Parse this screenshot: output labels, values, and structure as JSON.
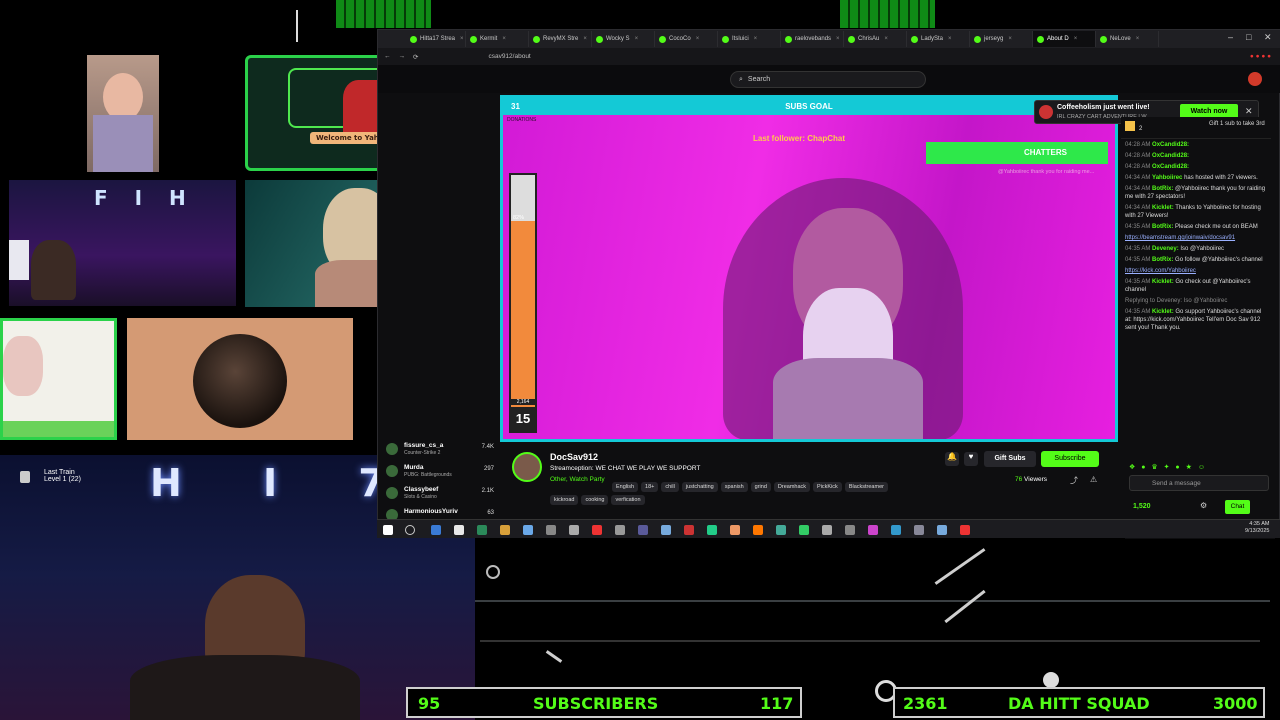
{
  "browser": {
    "tabs": [
      {
        "label": "Hitta17 Strea"
      },
      {
        "label": "Kermit"
      },
      {
        "label": "RevyMX Stre"
      },
      {
        "label": "Wocky S"
      },
      {
        "label": "CocoCo"
      },
      {
        "label": "Itsluici"
      },
      {
        "label": "raelovebands"
      },
      {
        "label": "ChrisAu"
      },
      {
        "label": "LadySta"
      },
      {
        "label": "jerseyg"
      },
      {
        "label": "About D",
        "active": true
      },
      {
        "label": "NeLove"
      }
    ],
    "url": "csav912/about"
  },
  "kick": {
    "search_placeholder": "Search"
  },
  "video_overlay": {
    "goal_count": "31",
    "goal_title": "SUBS GOAL",
    "donations_label": "DONATIONS",
    "last_follower": "Last follower: ChapChat",
    "chatters": "CHATTERS",
    "progress_pct": "82%",
    "progress_fraction": 0.82,
    "count1": "2,164",
    "count2": "15"
  },
  "notification": {
    "title": "Coffeeholism just went live!",
    "subtitle": "IRL CRAZY CART ADVENTURE | W...",
    "button": "Watch now"
  },
  "stream": {
    "streamer": "DocSav912",
    "title": "Streamception: WE CHAT WE PLAY WE SUPPORT",
    "category": "Other, Watch Party",
    "tags_row1": [
      "English",
      "18+",
      "chill",
      "justchatting",
      "spanish",
      "grind",
      "Dreamhack",
      "PickKick",
      "Blackstreamer"
    ],
    "tags_row2": [
      "kickroad",
      "cooking",
      "verfication"
    ],
    "gift_label": "Gift Subs",
    "subscribe_label": "Subscribe",
    "viewers": "76",
    "viewers_label": "Viewers"
  },
  "sidebar_channels": [
    {
      "name": "fissure_cs_a",
      "game": "Counter-Strike 2",
      "viewers": "7.4K"
    },
    {
      "name": "Murda",
      "game": "PUBG: Battlegrounds",
      "viewers": "297"
    },
    {
      "name": "Classybeef",
      "game": "Slots & Casino",
      "viewers": "2.1K"
    },
    {
      "name": "HarmoniousYuriv",
      "game": "",
      "viewers": "63"
    }
  ],
  "chat": {
    "pinned_top": "Gift 1 sub to take 3rd",
    "pinned_count": "2",
    "lines": [
      {
        "time": "04:28 AM",
        "user": "OxCandid28:",
        "text": ""
      },
      {
        "time": "04:28 AM",
        "user": "OxCandid28:",
        "text": ""
      },
      {
        "time": "04:28 AM",
        "user": "OxCandid28:",
        "text": ""
      },
      {
        "time": "04:34 AM",
        "user": "Yahboiirec",
        "text": "has hosted with 27 viewers."
      },
      {
        "time": "04:34 AM",
        "user": "BotRix:",
        "text": "@Yahboiirec thank you for raiding me with 27 spectators!"
      },
      {
        "time": "04:34 AM",
        "user": "Kicklet:",
        "text": "Thanks to Yahboiirec for hosting with 27 Viewers!"
      },
      {
        "time": "04:35 AM",
        "user": "BotRix:",
        "text": "Please check me out on BEAM"
      },
      {
        "time": "04:35 AM",
        "user": "Deveney:",
        "text": "Iso @Yahboiirec"
      },
      {
        "time": "04:35 AM",
        "user": "BotRix:",
        "text": "Go follow @Yahboiirec's channel"
      },
      {
        "time": "04:35 AM",
        "user": "Kicklet:",
        "text": "Go check out @Yahboiirec's channel"
      },
      {
        "time": "04:35 AM",
        "user": "Kicklet:",
        "text": "Go support Yahboiirec's channel at: https://kick.com/Yahboiirec Tell'em Doc Sav 912 sent you! Thank you."
      }
    ],
    "link1": "https://beamstream.gg/joinwaiv/docsav91",
    "link2": "https://kick.com/Yahboiirec",
    "reply_to": "Replying to Deveney: Iso @Yahboiirec",
    "input_placeholder": "Send a message",
    "points": "1,520",
    "chat_button": "Chat"
  },
  "taskbar": {
    "time": "4:35 AM",
    "date": "9/13/2025"
  },
  "overlay": {
    "last_train": "Last Train",
    "last_train_level": "Level 1 (22)",
    "cam_left_text": "F I H",
    "cam_bottom_text": "H I 7",
    "welcome": "Welcome to Yahboiirec!",
    "subs_current": "95",
    "subs_label": "SUBSCRIBERS",
    "subs_goal": "117",
    "squad_current": "2361",
    "squad_label": "DA HITT SQUAD",
    "squad_goal": "3000"
  },
  "colors": {
    "kick_green": "#53fc18",
    "overlay_cyan": "#14c9d6",
    "magenta": "#e020dc",
    "counter_green": "#53fc18"
  }
}
